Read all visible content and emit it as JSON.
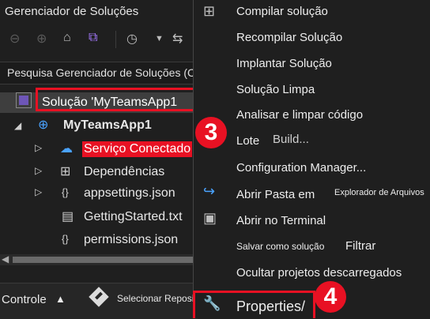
{
  "pane": {
    "title": "Gerenciador de Soluções",
    "search_placeholder": "Pesquisa Gerenciador de Soluções (Ctrl+"
  },
  "tree": {
    "solution": "Solução 'MyTeamsApp1",
    "project": "MyTeamsApp1",
    "items": [
      {
        "label": "Serviço Conectado",
        "icon": "connected-service-icon"
      },
      {
        "label": "Dependências",
        "icon": "dependencies-icon"
      },
      {
        "label": "appsettings.json",
        "icon": "json-file-icon"
      },
      {
        "label": "GettingStarted.txt",
        "icon": "text-file-icon"
      },
      {
        "label": "permissions.json",
        "icon": "json-file-icon"
      }
    ]
  },
  "badges": {
    "step3": "3",
    "step4": "4"
  },
  "bottom": {
    "controle": "Controle",
    "repo": "Selecionar Repositório"
  },
  "menu": {
    "compile": "Compilar solução",
    "recompile": "Recompilar Solução",
    "deploy": "Implantar Solução",
    "clean": "Solução Limpa",
    "analyze": "Analisar e limpar código",
    "batch": "Lote",
    "build": "Build...",
    "config": "Configuration Manager...",
    "open_folder": "Abrir Pasta em",
    "explorer": "Explorador de Arquivos",
    "terminal": "Abrir no Terminal",
    "save_filter": "Salvar como solução",
    "filter": "Filtrar",
    "hide_unloaded": "Ocultar projetos descarregados",
    "properties": "Properties/"
  },
  "colors": {
    "highlight": "#e81123",
    "accent": "#7b5cd6"
  }
}
